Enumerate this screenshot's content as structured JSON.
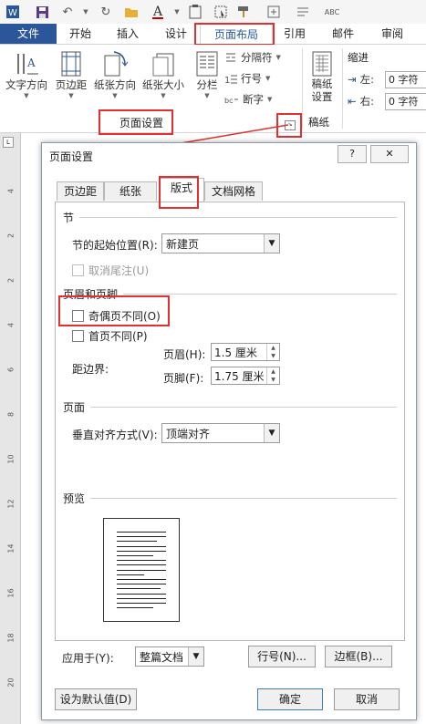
{
  "qat": {
    "icons": [
      "word-app-icon",
      "save-icon",
      "undo-icon",
      "redo-icon",
      "open-folder-icon",
      "font-color-icon",
      "clipboard-icon",
      "select-icon",
      "format-painter-icon",
      "show-marks-icon",
      "spell-check-icon"
    ]
  },
  "tabs": {
    "file": "文件",
    "home": "开始",
    "insert": "插入",
    "design": "设计",
    "layout": "页面布局",
    "references": "引用",
    "mailings": "邮件",
    "review": "审阅"
  },
  "ribbon": {
    "text_direction": "文字方向",
    "margins": "页边距",
    "orientation": "纸张方向",
    "size": "纸张大小",
    "columns": "分栏",
    "breaks": "分隔符",
    "line_numbers": "行号",
    "hyphenation": "断字",
    "page_setup_group": "页面设置",
    "draft_settings": "稿纸设置",
    "draft_group": "稿纸",
    "indent_title": "缩进",
    "indent_left_label": "左:",
    "indent_left_value": "0 字符",
    "indent_right_label": "右:",
    "indent_right_value": "0 字符"
  },
  "ruler": {
    "numbers": [
      "4",
      "2",
      "2",
      "4",
      "6",
      "8",
      "10",
      "12",
      "14",
      "16",
      "18",
      "20"
    ]
  },
  "dialog": {
    "title": "页面设置",
    "help": "?",
    "close": "✕",
    "tabs": {
      "margins": "页边距",
      "paper": "纸张",
      "layout": "版式",
      "grid": "文档网格"
    },
    "section_label": "节",
    "section_start_label": "节的起始位置(R):",
    "section_start_value": "新建页",
    "suppress_endnotes": "取消尾注(U)",
    "header_footer_label": "页眉和页脚",
    "odd_even": "奇偶页不同(O)",
    "first_page": "首页不同(P)",
    "from_edge": "距边界:",
    "header_label": "页眉(H):",
    "header_value": "1.5 厘米",
    "footer_label": "页脚(F):",
    "footer_value": "1.75 厘米",
    "page_label": "页面",
    "valign_label": "垂直对齐方式(V):",
    "valign_value": "顶端对齐",
    "preview_label": "预览",
    "apply_label": "应用于(Y):",
    "apply_value": "整篇文档",
    "line_numbers_btn": "行号(N)...",
    "borders_btn": "边框(B)...",
    "default_btn": "设为默认值(D)",
    "ok": "确定",
    "cancel": "取消"
  },
  "colors": {
    "accent": "#2b579a",
    "highlight": "#e03030"
  }
}
